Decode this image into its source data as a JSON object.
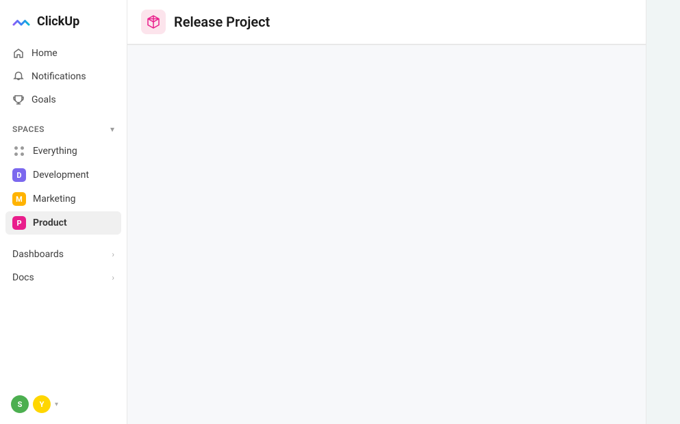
{
  "app": {
    "name": "ClickUp"
  },
  "sidebar": {
    "nav": [
      {
        "id": "home",
        "label": "Home",
        "icon": "home"
      },
      {
        "id": "notifications",
        "label": "Notifications",
        "icon": "bell"
      },
      {
        "id": "goals",
        "label": "Goals",
        "icon": "trophy"
      }
    ],
    "spaces_label": "Spaces",
    "spaces": [
      {
        "id": "everything",
        "label": "Everything",
        "type": "dots"
      },
      {
        "id": "development",
        "label": "Development",
        "type": "avatar",
        "color": "#7B68EE",
        "letter": "D"
      },
      {
        "id": "marketing",
        "label": "Marketing",
        "type": "avatar",
        "color": "#FFB300",
        "letter": "M"
      },
      {
        "id": "product",
        "label": "Product",
        "type": "avatar",
        "color": "#E91E8C",
        "letter": "P",
        "active": true
      }
    ],
    "bottom_items": [
      {
        "id": "dashboards",
        "label": "Dashboards",
        "has_chevron": true
      },
      {
        "id": "docs",
        "label": "Docs",
        "has_chevron": true
      }
    ],
    "footer": {
      "avatars": [
        "S",
        "Y"
      ]
    }
  },
  "header": {
    "project_title": "Release Project"
  }
}
